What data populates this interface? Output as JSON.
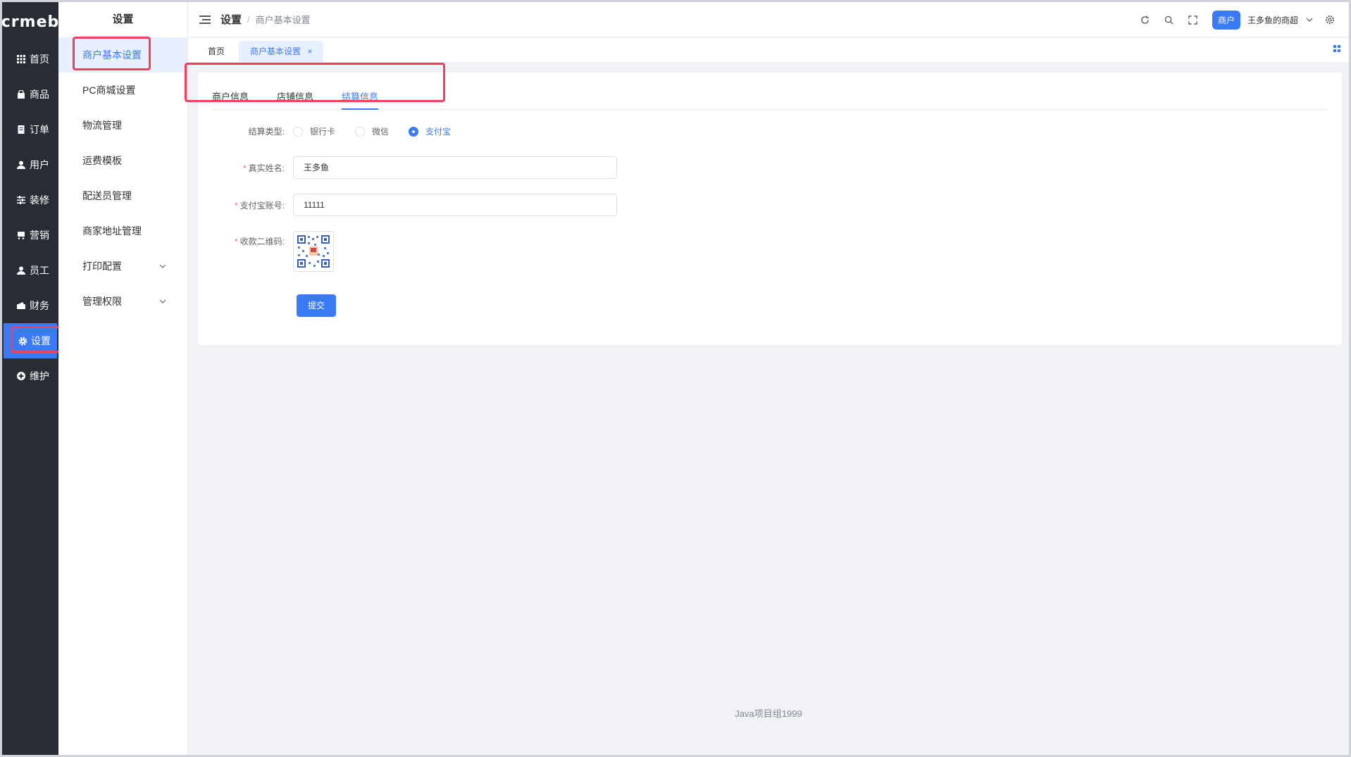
{
  "rail": {
    "logo": "crmeb",
    "items": [
      {
        "label": "首页",
        "icon": "grid-icon"
      },
      {
        "label": "商品",
        "icon": "bag-icon"
      },
      {
        "label": "订单",
        "icon": "document-icon"
      },
      {
        "label": "用户",
        "icon": "user-icon"
      },
      {
        "label": "装修",
        "icon": "sliders-icon"
      },
      {
        "label": "营销",
        "icon": "cart-icon"
      },
      {
        "label": "员工",
        "icon": "staff-icon"
      },
      {
        "label": "财务",
        "icon": "wallet-icon"
      },
      {
        "label": "设置",
        "icon": "gear-icon"
      },
      {
        "label": "维护",
        "icon": "plus-circle-icon"
      }
    ]
  },
  "side": {
    "title": "设置",
    "items": [
      {
        "label": "商户基本设置"
      },
      {
        "label": "PC商城设置"
      },
      {
        "label": "物流管理"
      },
      {
        "label": "运费模板"
      },
      {
        "label": "配送员管理"
      },
      {
        "label": "商家地址管理"
      },
      {
        "label": "打印配置"
      },
      {
        "label": "管理权限"
      }
    ]
  },
  "header": {
    "breadcrumb_root": "设置",
    "breadcrumb_sep": "/",
    "breadcrumb_current": "商户基本设置",
    "role_badge": "商户",
    "user_name": "王多鱼的商超"
  },
  "page_tabs": [
    {
      "label": "首页"
    },
    {
      "label": "商户基本设置",
      "close": "×"
    }
  ],
  "content_tabs": [
    {
      "label": "商户信息"
    },
    {
      "label": "店铺信息"
    },
    {
      "label": "结算信息"
    }
  ],
  "form": {
    "settlement_label": "结算类型:",
    "options": [
      "银行卡",
      "微信",
      "支付宝"
    ],
    "selected": "支付宝",
    "real_name_label": "真实姓名:",
    "real_name_value": "王多鱼",
    "alipay_label": "支付宝账号:",
    "alipay_value": "11111",
    "qr_label": "收款二维码:",
    "required_mark": "*",
    "submit_label": "提交"
  },
  "footer": "Java项目组1999",
  "colors": {
    "accent": "#3a7af5",
    "rail_bg": "#282c34",
    "highlight": "#f2405c"
  }
}
